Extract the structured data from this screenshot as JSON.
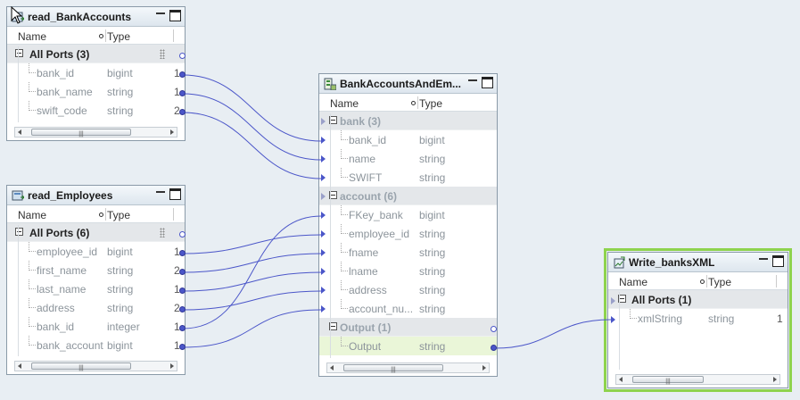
{
  "objects": {
    "bankaccounts": {
      "title": "read_BankAccounts",
      "col_name": "Name",
      "col_type": "Type",
      "group": "All Ports (3)",
      "rows": [
        {
          "name": "bank_id",
          "type": "bigint",
          "n": "1"
        },
        {
          "name": "bank_name",
          "type": "string",
          "n": "1"
        },
        {
          "name": "swift_code",
          "type": "string",
          "n": "2"
        }
      ]
    },
    "employees": {
      "title": "read_Employees",
      "col_name": "Name",
      "col_type": "Type",
      "group": "All Ports (6)",
      "rows": [
        {
          "name": "employee_id",
          "type": "bigint",
          "n": "1"
        },
        {
          "name": "first_name",
          "type": "string",
          "n": "2"
        },
        {
          "name": "last_name",
          "type": "string",
          "n": "1"
        },
        {
          "name": "address",
          "type": "string",
          "n": "2"
        },
        {
          "name": "bank_id",
          "type": "integer",
          "n": "1"
        },
        {
          "name": "bank_account",
          "type": "bigint",
          "n": "1"
        }
      ]
    },
    "xmlmap": {
      "title": "BankAccountsAndEm...",
      "col_name": "Name",
      "col_type": "Type",
      "group_bank": "bank (3)",
      "bank_rows": [
        {
          "name": "bank_id",
          "type": "bigint"
        },
        {
          "name": "name",
          "type": "string"
        },
        {
          "name": "SWIFT",
          "type": "string"
        }
      ],
      "group_account": "account (6)",
      "account_rows": [
        {
          "name": "FKey_bank",
          "type": "bigint"
        },
        {
          "name": "employee_id",
          "type": "string"
        },
        {
          "name": "fname",
          "type": "string"
        },
        {
          "name": "lname",
          "type": "string"
        },
        {
          "name": "address",
          "type": "string"
        },
        {
          "name": "account_nu...",
          "type": "string"
        }
      ],
      "group_output": "Output (1)",
      "output_rows": [
        {
          "name": "Output",
          "type": "string"
        }
      ]
    },
    "writexml": {
      "title": "Write_banksXML",
      "col_name": "Name",
      "col_type": "Type",
      "group": "All Ports (1)",
      "rows": [
        {
          "name": "xmlString",
          "type": "string",
          "n": "1"
        }
      ]
    }
  },
  "colors": {
    "wire": "#4b56c9",
    "selection": "#8ed34d",
    "highlight_row": "#eaf6d8"
  }
}
